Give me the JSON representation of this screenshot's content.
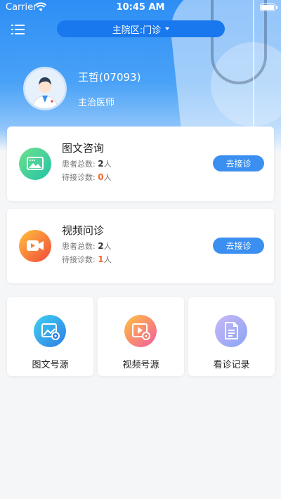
{
  "status_bar": {
    "carrier": "Carrier",
    "time": "10:45 AM"
  },
  "header": {
    "campus_selector": "主院区:门诊"
  },
  "doctor": {
    "name": "王哲(07093)",
    "title": "主治医师"
  },
  "cards": [
    {
      "title": "图文咨询",
      "total_label": "患者总数: ",
      "total_value": "2",
      "total_unit": "人",
      "pending_label": "待接诊数: ",
      "pending_value": "0",
      "pending_unit": "人",
      "action": "去接诊",
      "icon": "image-consult-icon"
    },
    {
      "title": "视频问诊",
      "total_label": "患者总数: ",
      "total_value": "2",
      "total_unit": "人",
      "pending_label": "待接诊数: ",
      "pending_value": "1",
      "pending_unit": "人",
      "action": "去接诊",
      "icon": "video-consult-icon"
    }
  ],
  "tiles": [
    {
      "label": "图文号源",
      "icon": "image-source-icon"
    },
    {
      "label": "视频号源",
      "icon": "video-source-icon"
    },
    {
      "label": "看诊记录",
      "icon": "records-icon"
    }
  ],
  "colors": {
    "primary": "#3b8ff0",
    "campus_bg": "#1a78ee",
    "pending_highlight": "#f26b2d",
    "card_bg": "#ffffff",
    "page_bg": "#f5f6f8"
  }
}
